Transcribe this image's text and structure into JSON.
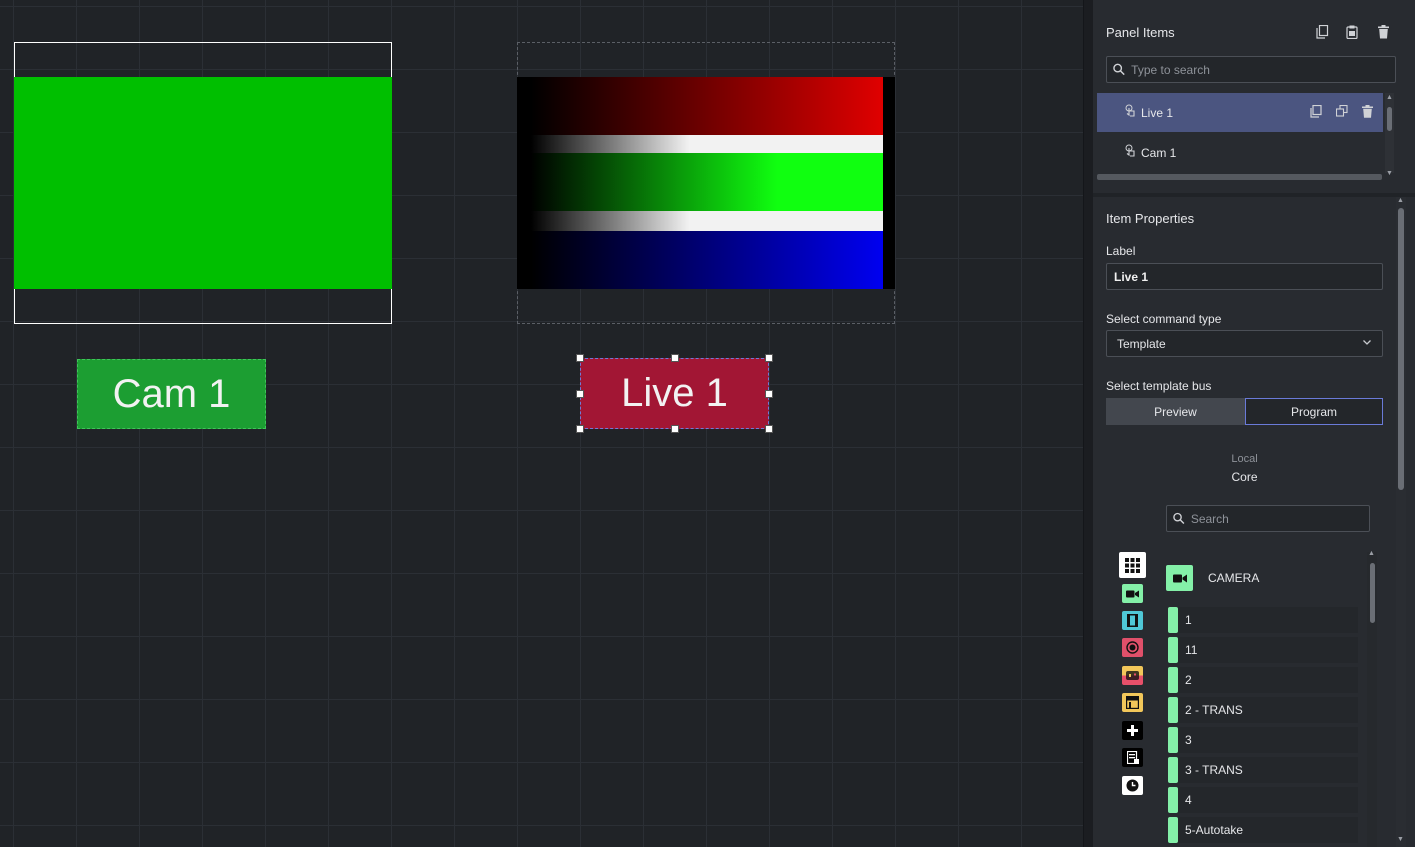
{
  "canvas": {
    "cam_button_label": "Cam 1",
    "live_button_label": "Live 1",
    "cam_preview_color": "#00bf00",
    "cam_button_color": "#1c9e32",
    "live_button_color": "#a21634"
  },
  "panel_items": {
    "title": "Panel Items",
    "search_placeholder": "Type to search",
    "items": [
      {
        "label": "Live 1",
        "active": true
      },
      {
        "label": "Cam 1",
        "active": false
      }
    ]
  },
  "item_properties": {
    "title": "Item Properties",
    "label_caption": "Label",
    "label_value": "Live 1",
    "command_type_caption": "Select command type",
    "command_type_value": "Template",
    "template_bus_caption": "Select template bus",
    "bus_options": [
      "Preview",
      "Program"
    ],
    "bus_selected": "Program",
    "source_scope": "Local",
    "source_name": "Core",
    "search_placeholder": "Search",
    "category_title": "CAMERA",
    "commands": [
      "1",
      "11",
      "2",
      "2 - TRANS",
      "3",
      "3 - TRANS",
      "4",
      "5-Autotake"
    ]
  },
  "categories": [
    {
      "icon": "grid-icon",
      "color": "#ffffff"
    },
    {
      "icon": "camera-icon",
      "color": "#84f0a8"
    },
    {
      "icon": "film-icon",
      "color": "#4fc7d6"
    },
    {
      "icon": "record-icon",
      "color": "#e0506a"
    },
    {
      "icon": "controller-icon",
      "color": "#e8506a"
    },
    {
      "icon": "layout-icon",
      "color": "#f2c75a"
    },
    {
      "icon": "plus-icon",
      "color": "#000000"
    },
    {
      "icon": "notes-icon",
      "color": "#000000"
    },
    {
      "icon": "clock-icon",
      "color": "#ffffff"
    }
  ]
}
